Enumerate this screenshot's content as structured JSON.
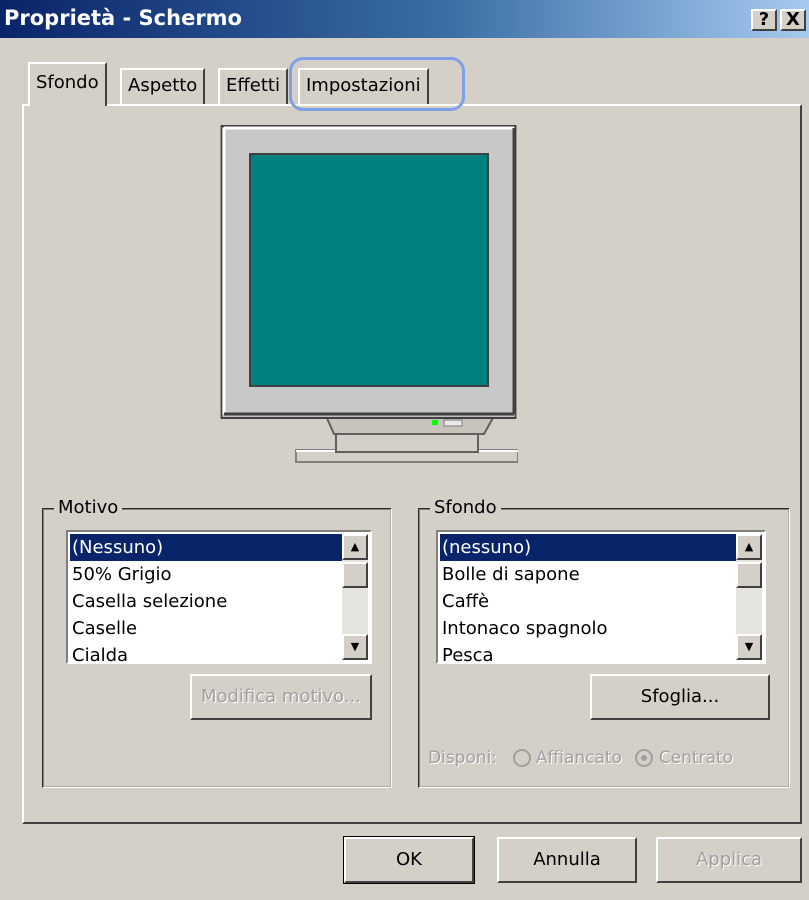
{
  "window": {
    "title": "Proprietà - Schermo",
    "help_label": "?",
    "close_label": "X"
  },
  "tabs": [
    {
      "label": "Sfondo",
      "active": true
    },
    {
      "label": "Aspetto",
      "active": false
    },
    {
      "label": "Effetti",
      "active": false
    },
    {
      "label": "Impostazioni",
      "active": false,
      "highlighted": true
    }
  ],
  "preview": {
    "screen_color": "#008080"
  },
  "motivo": {
    "label": "Motivo",
    "items": [
      "(Nessuno)",
      "50% Grigio",
      "Casella selezione",
      "Caselle",
      "Cialda"
    ],
    "selected_index": 0,
    "edit_button_label": "Modifica motivo..."
  },
  "sfondo": {
    "label": "Sfondo",
    "items": [
      "(nessuno)",
      "Bolle di sapone",
      "Caffè",
      "Intonaco spagnolo",
      "Pesca"
    ],
    "selected_index": 0,
    "browse_button_label": "Sfoglia...",
    "arrange_label": "Disponi:",
    "options": [
      {
        "label": "Affiancato",
        "checked": false
      },
      {
        "label": "Centrato",
        "checked": true
      }
    ]
  },
  "buttons": {
    "ok_label": "OK",
    "cancel_label": "Annulla",
    "apply_label": "Applica"
  },
  "colors": {
    "title_gradient_start": "#0a246a",
    "selection": "#0a246a",
    "window_face": "#d4d0c8",
    "tab_highlight": "#7f9fe6"
  }
}
